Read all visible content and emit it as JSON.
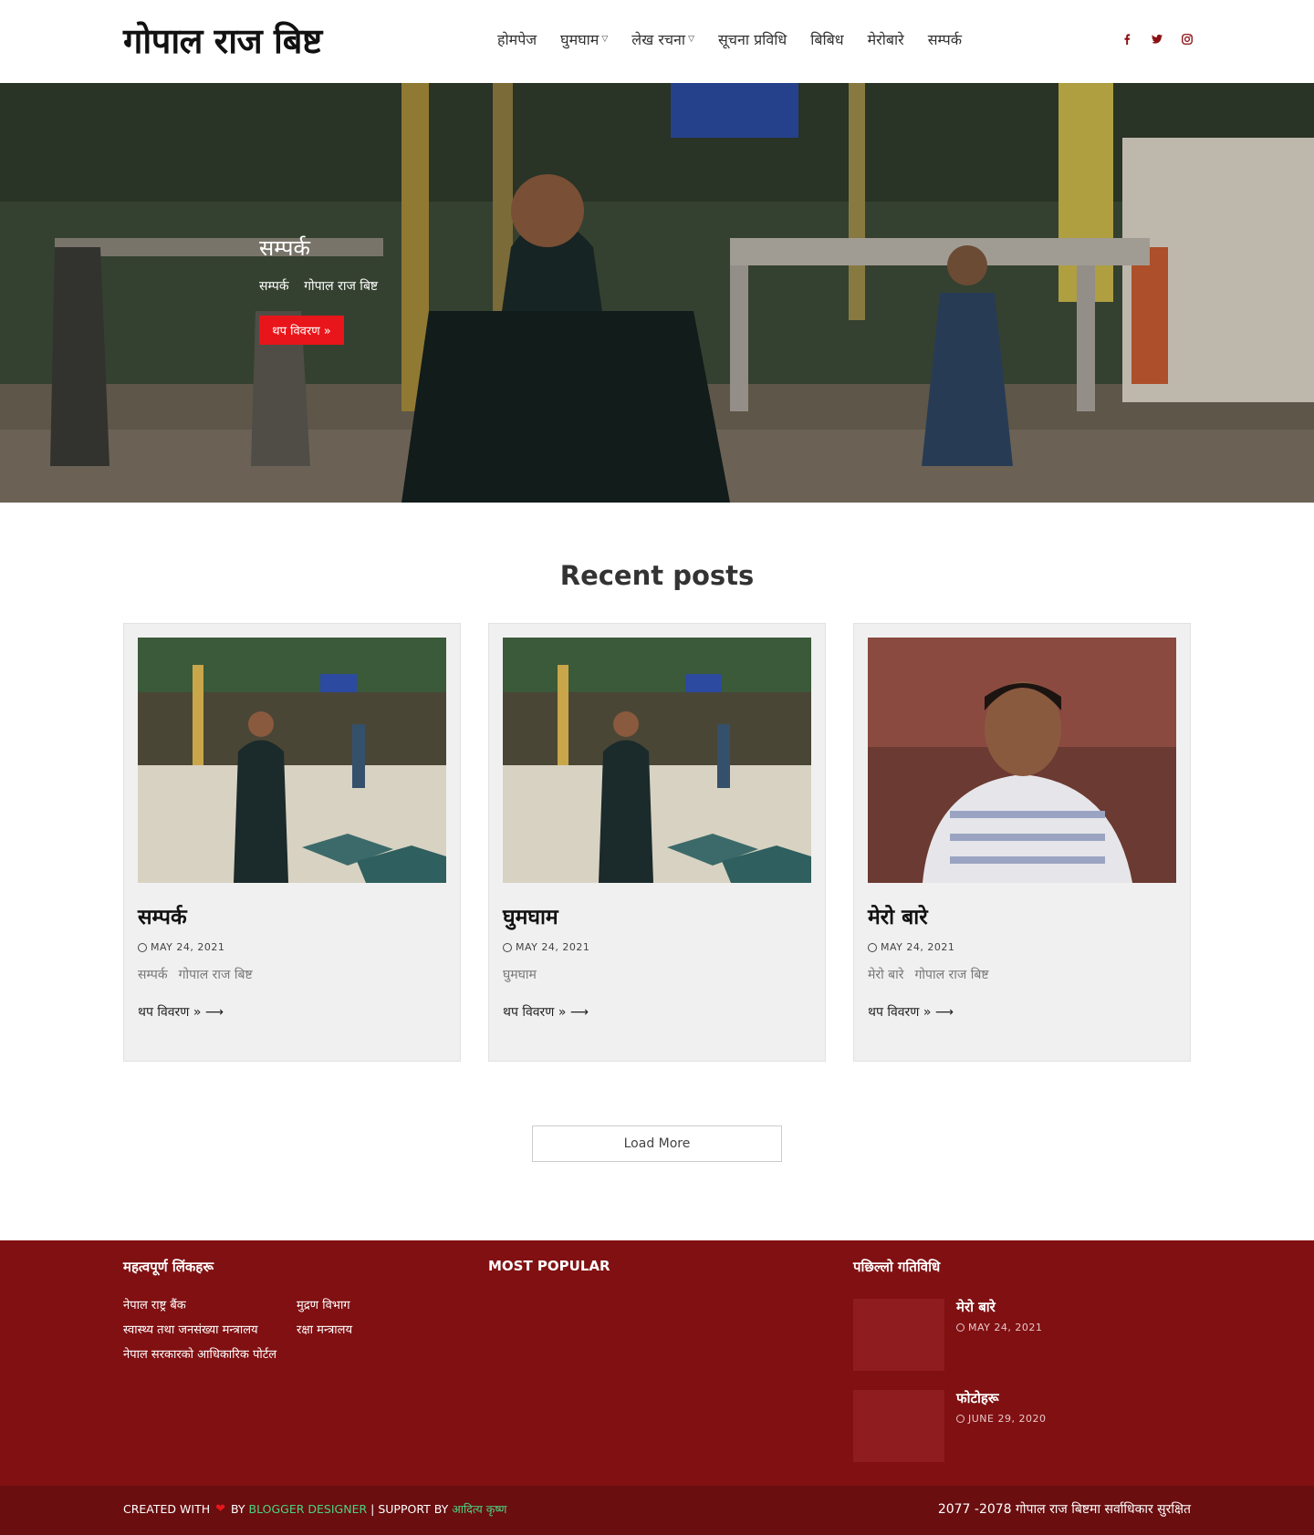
{
  "header": {
    "logo": "गोपाल राज बिष्ट",
    "nav": [
      {
        "label": "होमपेज",
        "has_dropdown": false
      },
      {
        "label": "घुमघाम",
        "has_dropdown": true
      },
      {
        "label": "लेख रचना",
        "has_dropdown": true
      },
      {
        "label": "सूचना प्रविधि",
        "has_dropdown": false
      },
      {
        "label": "बिबिध",
        "has_dropdown": false
      },
      {
        "label": "मेरोबारे",
        "has_dropdown": false
      },
      {
        "label": "सम्पर्क",
        "has_dropdown": false
      }
    ],
    "socials": [
      "facebook-icon",
      "twitter-icon",
      "instagram-icon"
    ]
  },
  "hero": {
    "title": "सम्पर्क",
    "meta_category": "सम्पर्क",
    "meta_author": "गोपाल राज बिष्ट",
    "button_label": "थप विवरण »"
  },
  "recent": {
    "heading": "Recent posts",
    "posts": [
      {
        "title": "सम्पर्क",
        "date": "MAY 24, 2021",
        "excerpt_a": "सम्पर्क",
        "excerpt_b": "गोपाल राज बिष्ट",
        "more": "थप विवरण » ⟶"
      },
      {
        "title": "घुमघाम",
        "date": "MAY 24, 2021",
        "excerpt_a": "घुमघाम",
        "excerpt_b": "",
        "more": "थप विवरण » ⟶"
      },
      {
        "title": "मेरो बारे",
        "date": "MAY 24, 2021",
        "excerpt_a": "मेरो बारे",
        "excerpt_b": "गोपाल राज बिष्ट",
        "more": "थप विवरण » ⟶"
      }
    ],
    "load_more": "Load More"
  },
  "footer": {
    "links_heading": "महत्वपूर्ण लिंकहरू",
    "links": [
      "नेपाल राष्ट्र बैंक",
      "स्वास्थ्य तथा जनसंख्या मन्त्रालय",
      "नेपाल सरकारको आधिकारिक पोर्टल",
      "मुद्रण विभाग",
      "रक्षा मन्त्रालय"
    ],
    "popular_heading": "MOST POPULAR",
    "recent_heading": "पछिल्लो गतिविधि",
    "recent_items": [
      {
        "title": "मेरो बारे",
        "date": "MAY 24, 2021"
      },
      {
        "title": "फोटोहरू",
        "date": "JUNE 29, 2020"
      }
    ],
    "credit_created": "CREATED WITH",
    "credit_by": "BY",
    "credit_designer": "BLOGGER DESIGNER",
    "credit_support": "| SUPPORT BY",
    "credit_supporter": "आदित्य कृष्ण",
    "copyright": "2077 -2078 गोपाल राज बिष्टमा सर्वाधिकार सुरक्षित"
  },
  "colors": {
    "accent_red": "#e8161b",
    "footer_bg": "#811012",
    "bottom_bar_bg": "#6a0e10",
    "credit_green": "#4cd47e"
  }
}
